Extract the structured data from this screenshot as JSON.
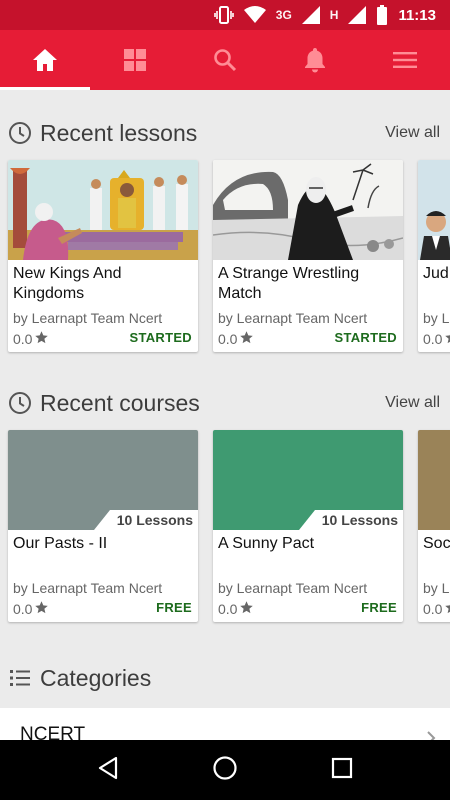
{
  "status_bar": {
    "network_1": "3G",
    "network_2": "H",
    "time": "11:13"
  },
  "toolbar": {
    "tabs": [
      {
        "icon": "home-icon",
        "active": true
      },
      {
        "icon": "grid-icon",
        "active": false
      },
      {
        "icon": "search-icon",
        "active": false
      },
      {
        "icon": "bell-icon",
        "active": false
      },
      {
        "icon": "menu-icon",
        "active": false
      }
    ]
  },
  "recent_lessons": {
    "title": "Recent lessons",
    "view_all": "View all",
    "icon": "clock-icon",
    "cards": [
      {
        "title": "New Kings And Kingdoms",
        "author": "by Learnapt Team Ncert",
        "rating": "0.0",
        "status": "STARTED"
      },
      {
        "title": "A Strange Wrestling Match",
        "author": "by Learnapt Team Ncert",
        "rating": "0.0",
        "status": "STARTED"
      },
      {
        "title": "Jud",
        "author": "by L",
        "rating": "0.0",
        "status": ""
      }
    ]
  },
  "recent_courses": {
    "title": "Recent courses",
    "view_all": "View all",
    "icon": "clock-icon",
    "cards": [
      {
        "title": "Our Pasts - II",
        "lessons": "10 Lessons",
        "author": "by Learnapt Team Ncert",
        "rating": "0.0",
        "price": "FREE",
        "color": "#7f8f8d"
      },
      {
        "title": "A Sunny Pact",
        "lessons": "10 Lessons",
        "author": "by Learnapt Team Ncert",
        "rating": "0.0",
        "price": "FREE",
        "color": "#3f9a71"
      },
      {
        "title": "Soc",
        "lessons": "",
        "author": "by L",
        "rating": "0.0",
        "price": "",
        "color": "#9a8358"
      }
    ]
  },
  "categories": {
    "title": "Categories",
    "icon": "list-icon",
    "items": [
      {
        "label": "NCERT"
      }
    ]
  },
  "colors": {
    "status_bar": "#c5122c",
    "toolbar": "#e61c36",
    "status_text": "#1d6b1d"
  },
  "nav_bar": {
    "buttons": [
      "back-icon",
      "home-circle-icon",
      "recents-icon"
    ]
  }
}
